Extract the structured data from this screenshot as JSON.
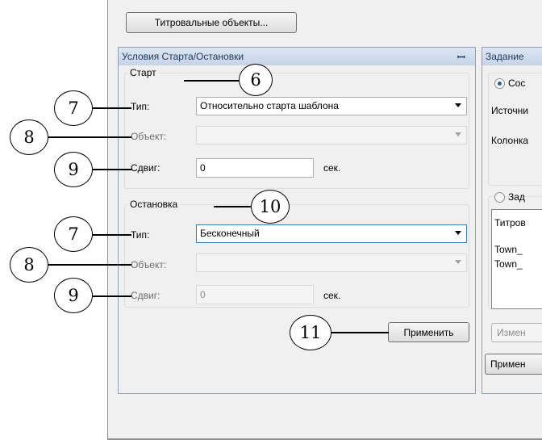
{
  "toolbar": {
    "title_objects_button": "Титровальные объекты..."
  },
  "left_panel": {
    "title": "Условия Старта/Остановки",
    "pin_icon": "pin-icon",
    "start": {
      "legend": "Старт",
      "type_label": "Тип:",
      "type_value": "Относительно старта шаблона",
      "object_label": "Объект:",
      "object_value": "",
      "shift_label": "Сдвиг:",
      "shift_value": "0",
      "shift_unit": "сек."
    },
    "stop": {
      "legend": "Остановка",
      "type_label": "Тип:",
      "type_value": "Бесконечный",
      "object_label": "Объект:",
      "object_value": "",
      "shift_label": "Сдвиг:",
      "shift_value": "0",
      "shift_unit": "сек."
    },
    "apply_button": "Применить"
  },
  "right_panel": {
    "title": "Задание",
    "radio1_label": "Сос",
    "source_label": "Источни",
    "column_label": "Колонка",
    "radio2_label": "Зад",
    "list_header": "Титров",
    "list_items": [
      "Town_",
      "Town_"
    ],
    "change_button": "Измен",
    "apply_button": "Примен"
  },
  "callouts": {
    "c6": "6",
    "c7a": "7",
    "c8a": "8",
    "c9a": "9",
    "c10": "10",
    "c7b": "7",
    "c8b": "8",
    "c9b": "9",
    "c11": "11"
  }
}
